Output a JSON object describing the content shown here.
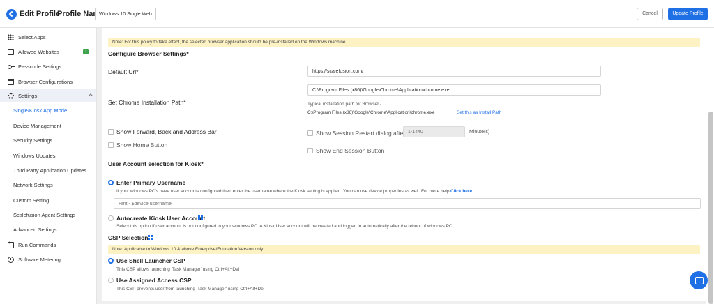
{
  "header": {
    "title": "Edit Profile",
    "profile_name_label": "Profile Name",
    "profile_name_value": "Windows 10 Single Website",
    "cancel_label": "Cancel",
    "update_label": "Update Profile"
  },
  "sidebar": {
    "items": [
      {
        "label": "Select Apps",
        "icon": "grid-icon"
      },
      {
        "label": "Allowed Websites",
        "icon": "window-icon",
        "badge": "1"
      },
      {
        "label": "Passcode Settings",
        "icon": "key-icon"
      },
      {
        "label": "Browser Configurations",
        "icon": "browser-icon"
      },
      {
        "label": "Settings",
        "icon": "gear-icon"
      },
      {
        "label": "Run Commands",
        "icon": "terminal-icon"
      },
      {
        "label": "Software Metering",
        "icon": "meter-icon"
      }
    ],
    "sub_items": [
      "Single/Kiosk App Mode",
      "Device Management",
      "Security Settings",
      "Windows Updates",
      "Third Party Application Updates",
      "Network Settings",
      "Custom Setting",
      "Scalefusion Agent Settings",
      "Advanced Settings"
    ]
  },
  "main": {
    "note_browser": "Note: For this policy to take effect, the selected browser application should be pre-installed on the Windows machine.",
    "configure_heading": "Configure Browser Settings*",
    "default_url_label": "Default Url*",
    "default_url_value": "https://scalefusion.com/",
    "chrome_path_label": "Set Chrome Installation Path*",
    "chrome_path_value": "C:\\Program Files (x86)\\Google\\Chrome\\Application\\chrome.exe",
    "typical_path_label": "Typical installation path for Browser -",
    "typical_path_value": "C:\\Program Files (x86)\\Google\\Chrome\\Application\\chrome.exe",
    "set_install_path_link": "Set this as Install Path",
    "show_forward_label": "Show Forward, Back and Address Bar",
    "show_home_label": "Show Home Button",
    "show_session_restart_label": "Show Session Restart dialog after",
    "session_minutes_placeholder": "1-1440",
    "minutes_label": "Minute(s)",
    "show_end_session_label": "Show End Session Button",
    "user_account_heading": "User Account selection for Kiosk*",
    "enter_primary_label": "Enter Primary Username",
    "enter_primary_desc": "If your windows PC's have user accounts configured then enter the username where the Kiosk setting is applied. You can use device properties as well. For more help",
    "click_here_link": "Click here",
    "username_placeholder": "Hint - $device.username",
    "autocreate_label": "Autocreate Kiosk User Account",
    "autocreate_desc": "Select this option if user account is not configured in your windows PC. A Kiosk User account will be created and logged in automatically after the reboot of windows PC.",
    "csp_heading": "CSP Selection",
    "note_csp": "Note: Applicable to Windows 10 & above Enterprise/Education Version only",
    "shell_launcher_label": "Use Shell Launcher CSP",
    "shell_launcher_desc": "This CSP allows launching 'Task Manager' using Ctrl+Alt+Del",
    "assigned_access_label": "Use Assigned Access CSP",
    "assigned_access_desc": "This CSP prevents user from launching 'Task Manager' using Ctrl+Alt+Del"
  },
  "colors": {
    "accent": "#1f6fe5",
    "note_bg": "#fdf2c4",
    "badge": "#3fa34d"
  }
}
